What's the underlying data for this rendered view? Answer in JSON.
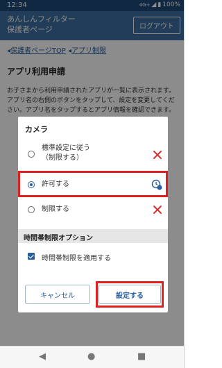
{
  "status_bar": {
    "time": "12:34",
    "network": "4G+",
    "battery": "100%"
  },
  "header": {
    "title_line1": "あんしんフィルター",
    "title_line2": "保護者ページ",
    "logout_label": "ログアウト"
  },
  "breadcrumb": {
    "item1": "保護者ページTOP",
    "item2": "アプリ制限"
  },
  "page": {
    "title": "アプリ利用申請",
    "description": "お子さまから利用申請されたアプリが一覧に表示されます。アプリ名の右側のボタンをタップして、設定を変更してください。アプリ名をタップするとアプリ情報を確認できます。"
  },
  "dialog": {
    "title": "カメラ",
    "options": [
      {
        "label_line1": "標準設定に従う",
        "label_line2": "（制限する）",
        "selected": false,
        "icon": "x-icon"
      },
      {
        "label_line1": "許可する",
        "label_line2": "",
        "selected": true,
        "icon": "clock-icon"
      },
      {
        "label_line1": "制限する",
        "label_line2": "",
        "selected": false,
        "icon": "x-icon"
      }
    ],
    "section_title": "時間帯制限オプション",
    "checkbox_label": "時間帯制限を適用する",
    "checkbox_checked": true,
    "cancel_label": "キャンセル",
    "confirm_label": "設定する"
  },
  "colors": {
    "header": "#3c6fa3",
    "statusbar": "#1f4a7a",
    "accent": "#2a5f9e",
    "highlight": "#e02020",
    "x_icon": "#d93030"
  }
}
